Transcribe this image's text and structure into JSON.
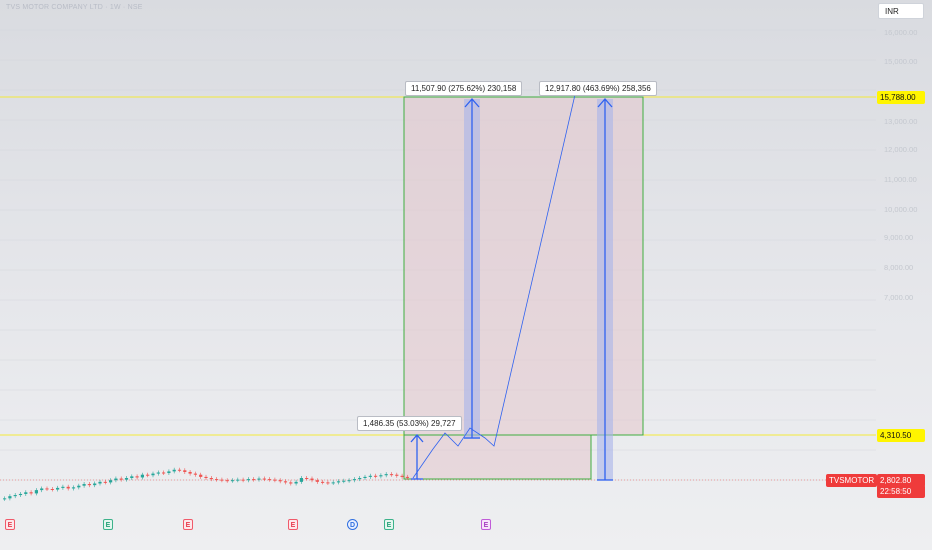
{
  "header": {
    "title": "TVS MOTOR COMPANY LTD · 1W · NSE",
    "currency": "INR"
  },
  "price_axis": {
    "ticks": [
      "16,000.00",
      "15,000.00",
      "13,000.00",
      "12,000.00",
      "11,000.00",
      "10,000.00",
      "9,000.00",
      "8,000.00",
      "7,000.00"
    ]
  },
  "price_tags": {
    "upper_level": "15,788.00",
    "lower_level": "4,310.50",
    "symbol": "TVSMOTOR",
    "last_price": "2,802.80",
    "countdown": "22:58:50"
  },
  "measurements": {
    "small": "1,486.35 (53.03%) 29,727",
    "mid": "11,507.90 (275.62%) 230,158",
    "large": "12,917.80 (463.69%) 258,356"
  },
  "events": [
    "E",
    "E",
    "E",
    "E",
    "D",
    "E",
    "E"
  ],
  "colors": {
    "up": "#26a69a",
    "down": "#ef5350",
    "box_border": "#3fae3f",
    "box_fill": "#e8c8cf",
    "arrow": "#2f62f0",
    "level_line": "#f4ea3a"
  },
  "chart_data": {
    "type": "candlestick",
    "levels": [
      15788.0,
      4310.5
    ],
    "last_price": 2802.8,
    "closes": [
      2430,
      2470,
      2490,
      2510,
      2540,
      2520,
      2580,
      2610,
      2600,
      2590,
      2620,
      2640,
      2610,
      2630,
      2660,
      2690,
      2670,
      2700,
      2730,
      2720,
      2760,
      2790,
      2770,
      2800,
      2830,
      2810,
      2860,
      2850,
      2880,
      2900,
      2890,
      2920,
      2950,
      2940,
      2910,
      2880,
      2860,
      2820,
      2800,
      2780,
      2770,
      2760,
      2750,
      2760,
      2770,
      2760,
      2780,
      2770,
      2790,
      2780,
      2770,
      2760,
      2740,
      2720,
      2700,
      2730,
      2800,
      2790,
      2760,
      2730,
      2720,
      2710,
      2720,
      2740,
      2750,
      2760,
      2780,
      2800,
      2820,
      2840,
      2830,
      2850,
      2870,
      2860,
      2840,
      2820,
      2803
    ]
  }
}
